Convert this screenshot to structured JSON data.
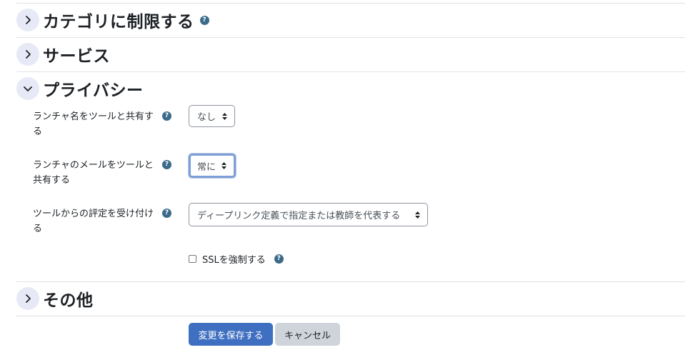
{
  "sections": {
    "category": {
      "title": "カテゴリに制限する",
      "help_icon": "question-circle-icon",
      "state": "collapsed"
    },
    "services": {
      "title": "サービス",
      "state": "collapsed"
    },
    "privacy": {
      "title": "プライバシー",
      "state": "expanded"
    },
    "other": {
      "title": "その他",
      "state": "collapsed"
    }
  },
  "privacy": {
    "share_name": {
      "label": "ランチャ名をツールと共有する",
      "value": "なし"
    },
    "share_email": {
      "label": "ランチャのメールをツールと共有する",
      "value": "常に"
    },
    "accept_grades": {
      "label": "ツールからの評定を受け付ける",
      "value": "ディープリンク定義で指定または教師を代表する"
    },
    "force_ssl": {
      "label": "SSLを強制する",
      "checked": false
    }
  },
  "buttons": {
    "save": "変更を保存する",
    "cancel": "キャンセル"
  },
  "colors": {
    "primary": "#3f6fc1",
    "secondary": "#ced4da",
    "help": "#3c6b8a",
    "chevron_bg": "#e7eaf6"
  }
}
